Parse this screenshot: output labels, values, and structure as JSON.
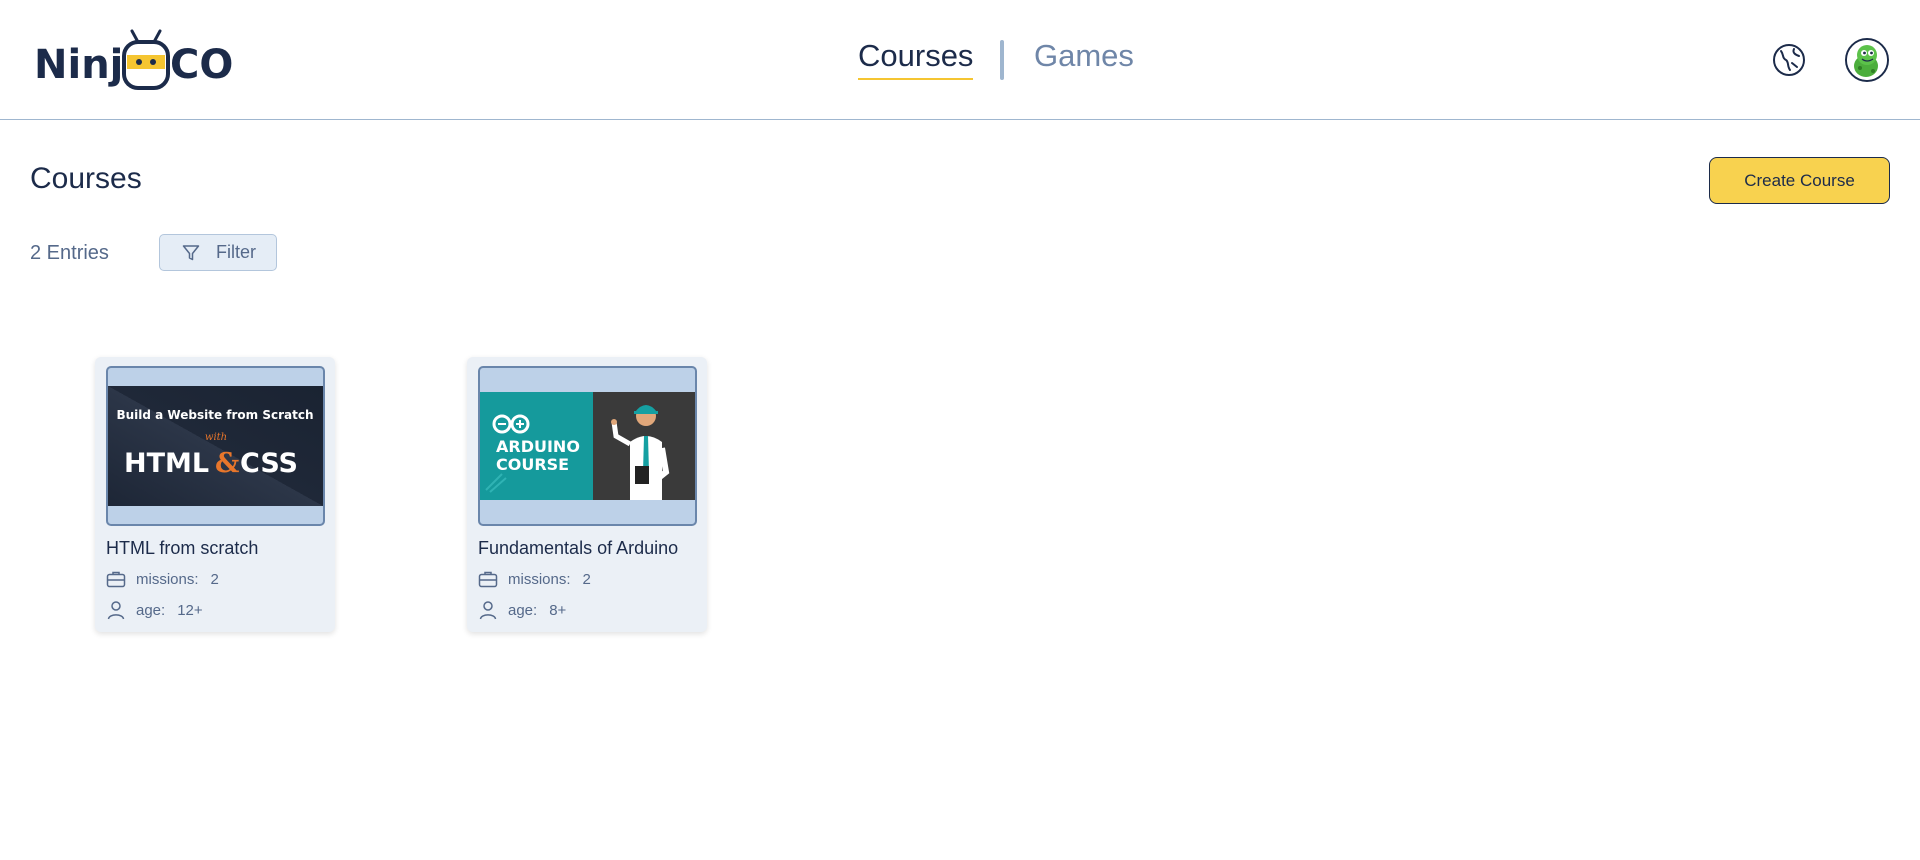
{
  "header": {
    "logo": {
      "text_left": "Ninj",
      "text_right": "CO"
    },
    "nav": {
      "courses": "Courses",
      "games": "Games"
    }
  },
  "main": {
    "title": "Courses",
    "create_button": "Create Course",
    "entries": "2 Entries",
    "filter_label": "Filter"
  },
  "cards": [
    {
      "title": "HTML from scratch",
      "missions_label": "missions:",
      "missions": "2",
      "age_label": "age:",
      "age": "12+",
      "thumb_line1": "Build a Website from Scratch",
      "thumb_with": "with",
      "thumb_html": "HTML",
      "thumb_amp": "&",
      "thumb_css": "CSS"
    },
    {
      "title": "Fundamentals of Arduino",
      "missions_label": "missions:",
      "missions": "2",
      "age_label": "age:",
      "age": "8+",
      "thumb_line1": "ARDUINO",
      "thumb_line2": "COURSE"
    }
  ],
  "colors": {
    "primary_text": "#1c2b4a",
    "accent_yellow": "#f8d24f",
    "nav_inactive": "#6f86a8",
    "card_bg": "#ebf0f6",
    "arduino_teal": "#159a9c"
  },
  "icons": {
    "language": "globe-icon",
    "filter": "filter-icon",
    "missions": "briefcase-icon",
    "age": "user-icon"
  }
}
